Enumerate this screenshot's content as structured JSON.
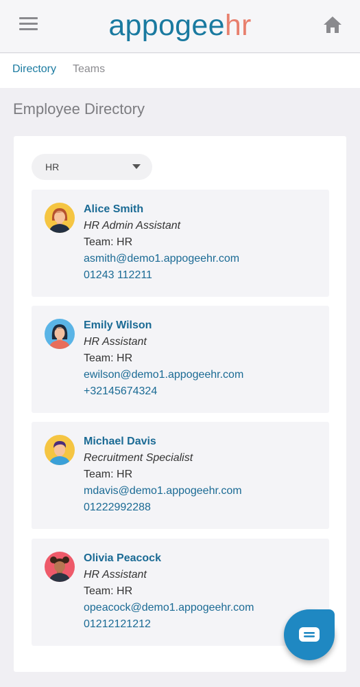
{
  "header": {
    "logo_part1": "appogee",
    "logo_part2": "hr",
    "menu_icon": "hamburger-menu-icon",
    "home_icon": "home-icon"
  },
  "tabs": [
    {
      "label": "Directory",
      "active": true
    },
    {
      "label": "Teams",
      "active": false
    }
  ],
  "page_title": "Employee Directory",
  "filter": {
    "selected": "HR"
  },
  "employees": [
    {
      "name": "Alice Smith",
      "role": "HR Admin Assistant",
      "team": "Team: HR",
      "email": "asmith@demo1.appogeehr.com",
      "phone": "01243 112211",
      "avatar_bg": "#f5c542"
    },
    {
      "name": "Emily Wilson",
      "role": "HR Assistant",
      "team": "Team: HR",
      "email": "ewilson@demo1.appogeehr.com",
      "phone": "+32145674324",
      "avatar_bg": "#5ab4e6"
    },
    {
      "name": "Michael Davis",
      "role": "Recruitment Specialist",
      "team": "Team: HR",
      "email": "mdavis@demo1.appogeehr.com",
      "phone": "01222992288",
      "avatar_bg": "#f5c542"
    },
    {
      "name": "Olivia Peacock",
      "role": "HR Assistant",
      "team": "Team: HR",
      "email": "opeacock@demo1.appogeehr.com",
      "phone": "01212121212",
      "avatar_bg": "#ee5a6a"
    }
  ],
  "chat": {
    "icon": "chat-bubble-icon"
  },
  "colors": {
    "brand_blue": "#1a7aa0",
    "brand_accent": "#e8806e",
    "link": "#1a6a94",
    "fab": "#1f88c2"
  }
}
